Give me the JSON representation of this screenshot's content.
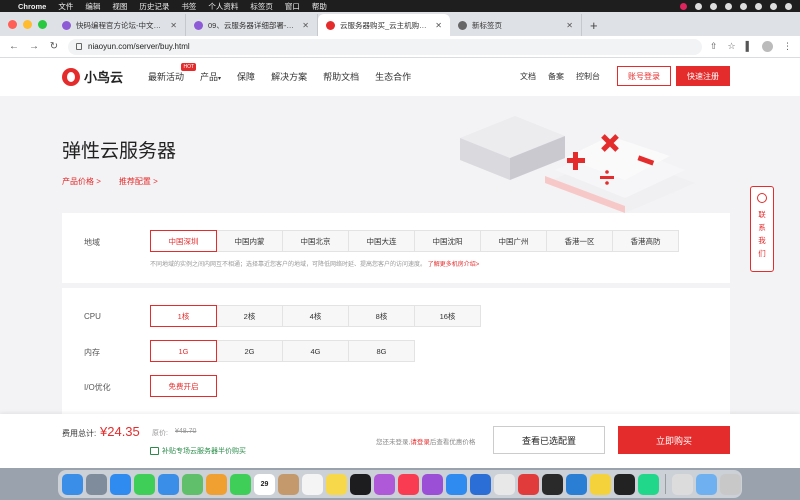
{
  "mac_menu": {
    "app_name": "Chrome",
    "items": [
      "文件",
      "编辑",
      "视图",
      "历史记录",
      "书签",
      "个人资料",
      "标签页",
      "窗口",
      "帮助"
    ]
  },
  "tabs": [
    {
      "title": "快码编程官方论坛-中文H5开发",
      "color": "#8e5bd6",
      "active": false
    },
    {
      "title": "09、云服务器详细部署-软件成型",
      "color": "#8e5bd6",
      "active": false
    },
    {
      "title": "云服务器购买_云主机购买_服务",
      "color": "#e52c2c",
      "active": true
    },
    {
      "title": "新标签页",
      "color": "#666666",
      "active": false
    }
  ],
  "address_bar": {
    "url": "niaoyun.com/server/buy.html"
  },
  "site": {
    "logo_text": "小鸟云",
    "nav": [
      {
        "label": "最新活动",
        "badge": "HOT"
      },
      {
        "label": "产品",
        "caret": "▾"
      },
      {
        "label": "保障"
      },
      {
        "label": "解决方案"
      },
      {
        "label": "帮助文档"
      },
      {
        "label": "生态合作"
      }
    ],
    "right_links": [
      "文档",
      "备案",
      "控制台"
    ],
    "login_label": "账号登录",
    "register_label": "快速注册"
  },
  "hero": {
    "title": "弹性云服务器",
    "link_price": "产品价格 >",
    "link_recommend": "推荐配置 >"
  },
  "region": {
    "label": "地域",
    "options": [
      "中国深圳",
      "中国内蒙",
      "中国北京",
      "中国大连",
      "中国沈阳",
      "中国广州",
      "香港一区",
      "香港高防"
    ],
    "selected": 0,
    "note": "不同地域的实例之间内网互不相通；选择靠近您客户的地域，可降低网络时延、提高您客户的访问速度。",
    "note_link": "了解更多机房介绍>"
  },
  "config": {
    "cpu_label": "CPU",
    "cpu_options": [
      "1核",
      "2核",
      "4核",
      "8核",
      "16核"
    ],
    "cpu_selected": 0,
    "mem_label": "内存",
    "mem_options": [
      "1G",
      "2G",
      "4G",
      "8G"
    ],
    "mem_selected": 0,
    "io_label": "I/O优化",
    "io_option": "免费开启"
  },
  "consult": {
    "chars": [
      "联",
      "系",
      "我",
      "们"
    ]
  },
  "footer": {
    "fee_label": "费用总计:",
    "fee_value": "¥24.35",
    "orig_label": "原价:",
    "orig_value": "¥48.70",
    "subsidy": "补贴专场云服务器半价购买",
    "note_prefix": "您还未登录,",
    "note_link": "请登录",
    "note_suffix": "后查看优惠价格",
    "view_label": "查看已选配置",
    "buy_label": "立即购买"
  },
  "dock": {
    "calendar_day": "29",
    "icons": [
      {
        "name": "finder-icon",
        "color": "#3b8ee8"
      },
      {
        "name": "launchpad-icon",
        "color": "#7f8c9c"
      },
      {
        "name": "safari-icon",
        "color": "#2f8bf0"
      },
      {
        "name": "messages-icon",
        "color": "#3fcf59"
      },
      {
        "name": "mail-icon",
        "color": "#3b8ee8"
      },
      {
        "name": "maps-icon",
        "color": "#5fbf6a"
      },
      {
        "name": "photos-icon",
        "color": "#f0a030"
      },
      {
        "name": "facetime-icon",
        "color": "#3fcf59"
      },
      {
        "name": "calendar-icon",
        "color": "#ffffff"
      },
      {
        "name": "contacts-icon",
        "color": "#c49a6c"
      },
      {
        "name": "reminders-icon",
        "color": "#f4f4f4"
      },
      {
        "name": "notes-icon",
        "color": "#f7d84a"
      },
      {
        "name": "tv-icon",
        "color": "#1d1d1f"
      },
      {
        "name": "podcasts-icon",
        "color": "#b059d8"
      },
      {
        "name": "music-icon",
        "color": "#fa3c52"
      },
      {
        "name": "podcasts-2-icon",
        "color": "#9b4fd6"
      },
      {
        "name": "appstore-icon",
        "color": "#2f8bf0"
      },
      {
        "name": "sourcetree-icon",
        "color": "#2b6fd6"
      },
      {
        "name": "chrome-icon",
        "color": "#e8e8e8"
      },
      {
        "name": "wps-icon",
        "color": "#e23b3b"
      },
      {
        "name": "terminal-icon",
        "color": "#2a2a2a"
      },
      {
        "name": "vscode-icon",
        "color": "#2a7fd4"
      },
      {
        "name": "lemon-icon",
        "color": "#f4d23b"
      },
      {
        "name": "qq-icon",
        "color": "#222222"
      },
      {
        "name": "pycharm-icon",
        "color": "#21d789"
      },
      {
        "name": "preview-icon",
        "color": "#dcdcdc"
      },
      {
        "name": "folder-icon",
        "color": "#6fb1f0"
      },
      {
        "name": "trash-icon",
        "color": "#c8c8c8"
      }
    ]
  }
}
